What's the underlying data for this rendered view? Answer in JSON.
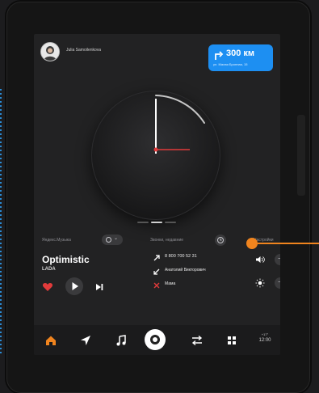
{
  "header": {
    "user_name": "Julia Samoilenkova"
  },
  "navigation": {
    "distance": "300 км",
    "destination": "ул. Малая Бронная, 15"
  },
  "clock": {
    "hour_hand_angle_deg": 90,
    "minute_hand_angle_deg": 0,
    "accent_color": "#e23b3b"
  },
  "pager": {
    "pages": 3,
    "active_index": 1
  },
  "music": {
    "service": "Яндекс.Музыка",
    "title": "Optimistic",
    "artist": "LADA"
  },
  "recent_calls": {
    "header": "Звонки, недавние",
    "items": [
      {
        "type": "outgoing",
        "icon": "outgoing-call-icon",
        "color": "#ffffff",
        "text": "8 800 700 52 31"
      },
      {
        "type": "incoming",
        "icon": "incoming-call-icon",
        "color": "#ffffff",
        "text": "Анатолий Викторович"
      },
      {
        "type": "missed",
        "icon": "missed-call-icon",
        "color": "#e23b3b",
        "text": "Мама"
      }
    ]
  },
  "side_panel": {
    "label": "Настройки",
    "minus": "−"
  },
  "dock": {
    "items": [
      "home-icon",
      "navigator-icon",
      "music-icon",
      "alice-icon",
      "transfer-icon",
      "apps-icon"
    ],
    "active": "home-icon",
    "accent": "#f0841e",
    "weather_line1": "+17°",
    "weather_line2": "12:00"
  }
}
